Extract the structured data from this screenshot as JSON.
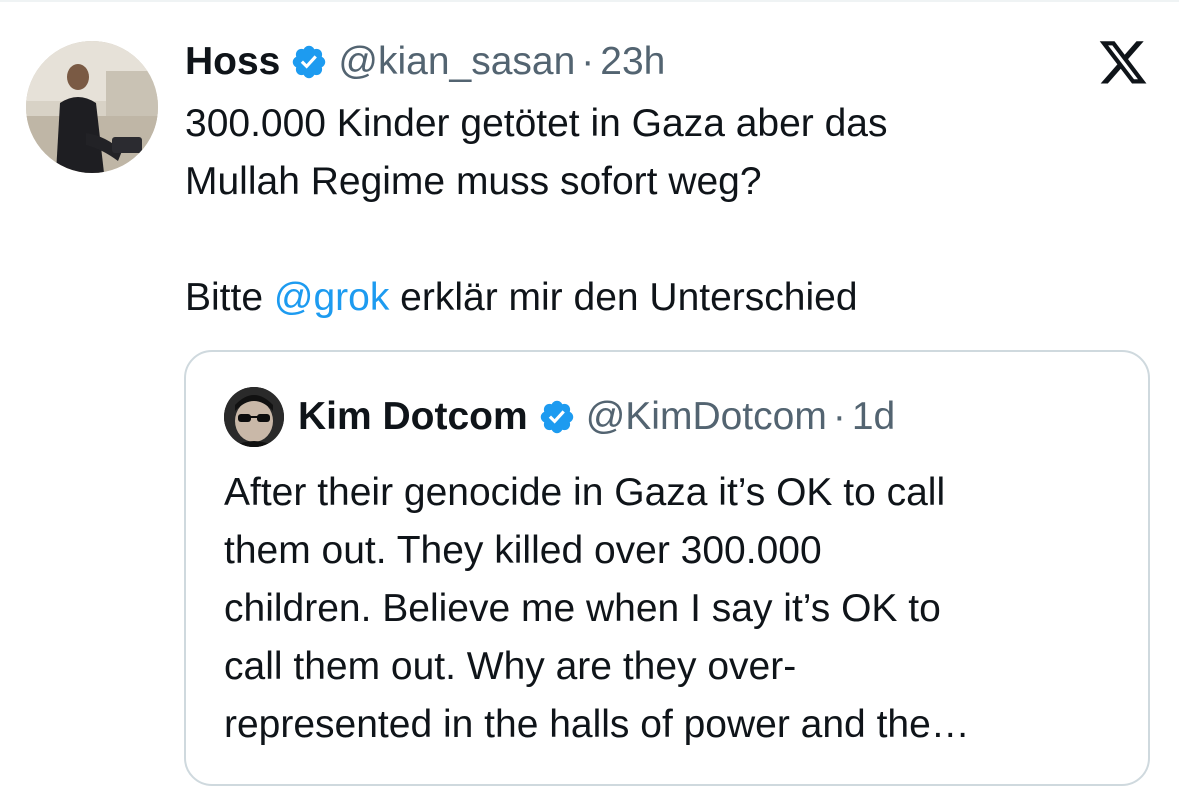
{
  "tweet": {
    "author_name": "Hoss",
    "author_handle": "@kian_sasan",
    "separator": "·",
    "time": "23h",
    "text_line1": "300.000 Kinder getötet in Gaza aber das",
    "text_line2": "Mullah Regime muss sofort weg?",
    "text_line3_prefix": "Bitte ",
    "text_line3_mention": "@grok",
    "text_line3_suffix": " erklär mir den Unterschied",
    "avatar_icon": "profile-photo",
    "verified_icon": "verified-badge-icon",
    "platform_icon": "x-logo-icon"
  },
  "quoted_tweet": {
    "author_name": "Kim Dotcom",
    "author_handle": "@KimDotcom",
    "separator": "·",
    "time": "1d",
    "text_lines": [
      "After their genocide in Gaza it’s OK to call",
      "them out. They killed over 300.000",
      "children. Believe me when I say it’s OK to",
      "call them out. Why are they over-",
      "represented in the halls of power and the…"
    ]
  },
  "colors": {
    "text_primary": "#0f1419",
    "text_secondary": "#536471",
    "link": "#1d9bf0",
    "verified": "#1d9bf0",
    "border": "#cfd9de"
  }
}
